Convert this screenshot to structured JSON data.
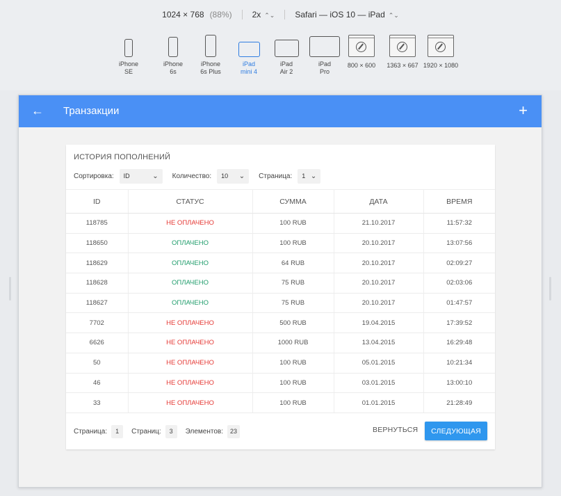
{
  "simulator": {
    "resolution": "1024 × 768",
    "zoom": "(88%)",
    "scale": "2x",
    "browser": "Safari — iOS 10 — iPad",
    "devices": [
      {
        "line1": "iPhone",
        "line2": "SE"
      },
      {
        "line1": "iPhone",
        "line2": "6s"
      },
      {
        "line1": "iPhone",
        "line2": "6s Plus"
      },
      {
        "line1": "iPad",
        "line2": "mini 4"
      },
      {
        "line1": "iPad",
        "line2": "Air 2"
      },
      {
        "line1": "iPad",
        "line2": "Pro"
      },
      {
        "line1": "800 × 600",
        "line2": ""
      },
      {
        "line1": "1363 × 667",
        "line2": ""
      },
      {
        "line1": "1920 × 1080",
        "line2": ""
      }
    ],
    "accent": "#2f7de1"
  },
  "appbar": {
    "title": "Транзакции",
    "back_icon": "←",
    "add_icon": "+",
    "color": "#4a90f5"
  },
  "card": {
    "title": "ИСТОРИЯ ПОПОЛНЕНИЙ",
    "filters": {
      "sort_label": "Сортировка:",
      "sort_value": "ID",
      "count_label": "Количество:",
      "count_value": "10",
      "page_label": "Страница:",
      "page_value": "1"
    },
    "columns": [
      "ID",
      "СТАТУС",
      "СУММА",
      "ДАТА",
      "ВРЕМЯ"
    ],
    "rows": [
      {
        "id": "118785",
        "status": "НЕ ОПЛАЧЕНО",
        "paid": false,
        "amount": "100 RUB",
        "date": "21.10.2017",
        "time": "11:57:32"
      },
      {
        "id": "118650",
        "status": "ОПЛАЧЕНО",
        "paid": true,
        "amount": "100 RUB",
        "date": "20.10.2017",
        "time": "13:07:56"
      },
      {
        "id": "118629",
        "status": "ОПЛАЧЕНО",
        "paid": true,
        "amount": "64 RUB",
        "date": "20.10.2017",
        "time": "02:09:27"
      },
      {
        "id": "118628",
        "status": "ОПЛАЧЕНО",
        "paid": true,
        "amount": "75 RUB",
        "date": "20.10.2017",
        "time": "02:03:06"
      },
      {
        "id": "118627",
        "status": "ОПЛАЧЕНО",
        "paid": true,
        "amount": "75 RUB",
        "date": "20.10.2017",
        "time": "01:47:57"
      },
      {
        "id": "7702",
        "status": "НЕ ОПЛАЧЕНО",
        "paid": false,
        "amount": "500 RUB",
        "date": "19.04.2015",
        "time": "17:39:52"
      },
      {
        "id": "6626",
        "status": "НЕ ОПЛАЧЕНО",
        "paid": false,
        "amount": "1000 RUB",
        "date": "13.04.2015",
        "time": "16:29:48"
      },
      {
        "id": "50",
        "status": "НЕ ОПЛАЧЕНО",
        "paid": false,
        "amount": "100 RUB",
        "date": "05.01.2015",
        "time": "10:21:34"
      },
      {
        "id": "46",
        "status": "НЕ ОПЛАЧЕНО",
        "paid": false,
        "amount": "100 RUB",
        "date": "03.01.2015",
        "time": "13:00:10"
      },
      {
        "id": "33",
        "status": "НЕ ОПЛАЧЕНО",
        "paid": false,
        "amount": "100 RUB",
        "date": "01.01.2015",
        "time": "21:28:49"
      }
    ],
    "footer": {
      "page_label": "Страница:",
      "page_value": "1",
      "pages_label": "Страниц:",
      "pages_value": "3",
      "items_label": "Элементов:",
      "items_value": "23"
    },
    "back_button": "ВЕРНУТЬСЯ",
    "next_button": "СЛЕДУЮЩАЯ",
    "colors": {
      "paid": "#1f9c6b",
      "unpaid": "#e53935",
      "primary_button": "#2f97ee"
    }
  }
}
